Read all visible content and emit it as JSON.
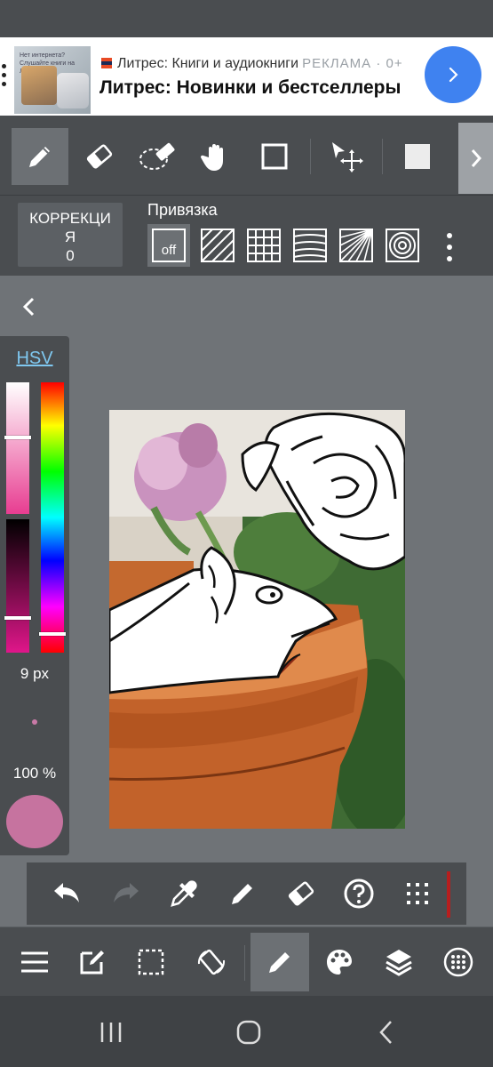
{
  "ad": {
    "source": "Литрес: Книги и аудиокниги",
    "label": "РЕКЛАМА · 0+",
    "title": "Литрес: Новинки и бестселлеры",
    "thumb_text": "Нет интернета? Слушайте книги на Литрес"
  },
  "toolbar": {
    "tools": [
      "pencil-icon",
      "eraser-icon",
      "lasso-eraser-icon",
      "hand-icon",
      "rectangle-icon",
      "move-icon",
      "fill-square-icon"
    ],
    "active_tool": "pencil-icon"
  },
  "correction": {
    "line1": "КОРРЕКЦИ",
    "line2": "Я",
    "value": "0"
  },
  "snap": {
    "label": "Привязка",
    "off_label": "off",
    "options": [
      "off",
      "parallel",
      "grid",
      "curve",
      "perspective",
      "concentric"
    ]
  },
  "color_panel": {
    "mode": "HSV",
    "brush_size": "9 px",
    "opacity": "100 %",
    "current_color": "#c6739f",
    "saturation_level": 0.42,
    "value_level": 0.74,
    "hue_level": 0.93
  },
  "colors": {
    "ui_dark": "#4a4d50",
    "workspace": "#6f7377",
    "ad_accent": "#3f82f0",
    "link": "#7fc8f0",
    "red_marker": "#b81e1e"
  },
  "actions": [
    "undo-icon",
    "redo-icon",
    "eyedropper-icon",
    "pen-icon",
    "eraser-icon",
    "help-icon",
    "grid-dots-icon"
  ],
  "bottom_nav": [
    "menu-icon",
    "edit-icon",
    "selection-icon",
    "rotate-icon",
    "brush-icon",
    "palette-icon",
    "layers-icon",
    "materials-icon"
  ]
}
